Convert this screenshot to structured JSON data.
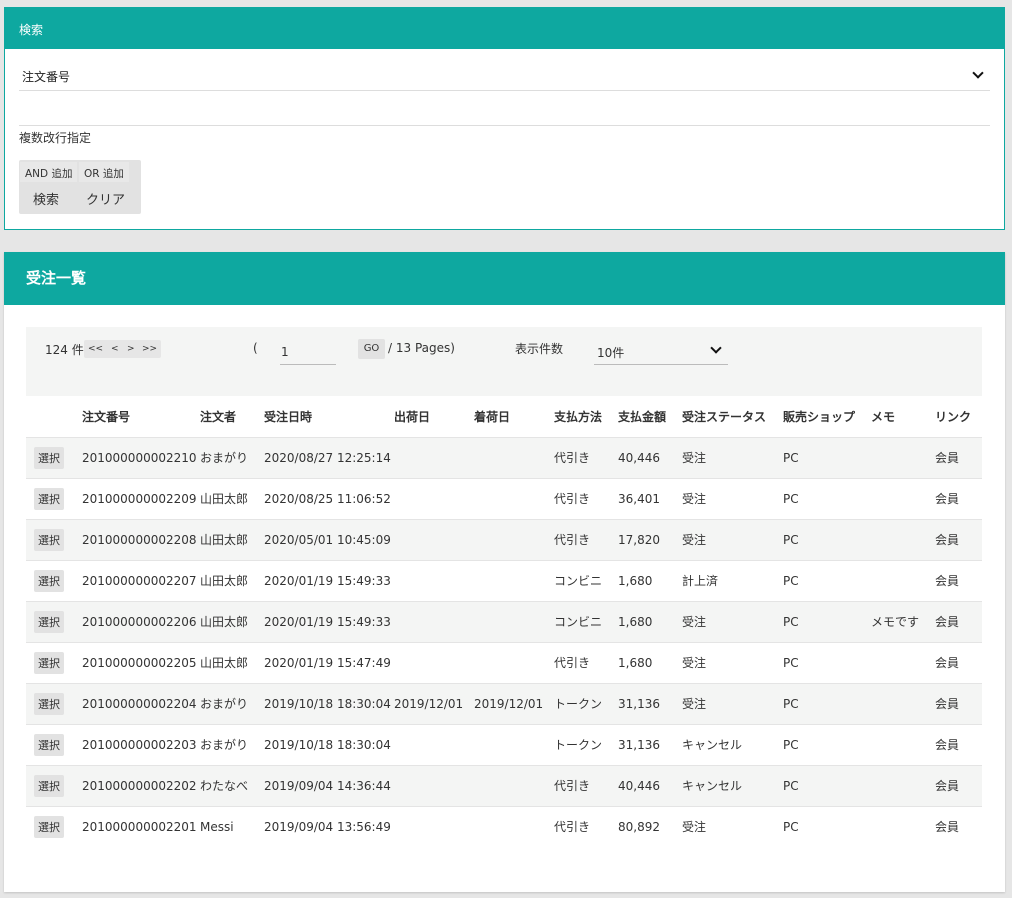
{
  "search": {
    "title": "検索",
    "field_value": "注文番号",
    "multi_line_label": "複数改行指定",
    "and_label": "AND 追加",
    "or_label": "OR 追加",
    "search_label": "検索",
    "clear_label": "クリア"
  },
  "list": {
    "title": "受注一覧",
    "count": "124 件",
    "pager": [
      "<<",
      "<",
      ">",
      ">>"
    ],
    "paren": "(",
    "page_value": "1",
    "go_label": "GO",
    "pages_text": "/ 13 Pages)",
    "per_page_label": "表示件数",
    "per_page_value": "10件",
    "columns": [
      "",
      "注文番号",
      "注文者",
      "受注日時",
      "出荷日",
      "着荷日",
      "支払方法",
      "支払金額",
      "受注ステータス",
      "販売ショップ",
      "メモ",
      "リンク"
    ],
    "select_label": "選択",
    "rows": [
      [
        "201000000002210",
        "おまがり",
        "2020/08/27 12:25:14",
        "",
        "",
        "代引き",
        "40,446",
        "受注",
        "PC",
        "",
        "会員"
      ],
      [
        "201000000002209",
        "山田太郎",
        "2020/08/25 11:06:52",
        "",
        "",
        "代引き",
        "36,401",
        "受注",
        "PC",
        "",
        "会員"
      ],
      [
        "201000000002208",
        "山田太郎",
        "2020/05/01 10:45:09",
        "",
        "",
        "代引き",
        "17,820",
        "受注",
        "PC",
        "",
        "会員"
      ],
      [
        "201000000002207",
        "山田太郎",
        "2020/01/19 15:49:33",
        "",
        "",
        "コンビニ",
        "1,680",
        "計上済",
        "PC",
        "",
        "会員"
      ],
      [
        "201000000002206",
        "山田太郎",
        "2020/01/19 15:49:33",
        "",
        "",
        "コンビニ",
        "1,680",
        "受注",
        "PC",
        "メモです",
        "会員"
      ],
      [
        "201000000002205",
        "山田太郎",
        "2020/01/19 15:47:49",
        "",
        "",
        "代引き",
        "1,680",
        "受注",
        "PC",
        "",
        "会員"
      ],
      [
        "201000000002204",
        "おまがり",
        "2019/10/18 18:30:04",
        "2019/12/01",
        "2019/12/01",
        "トークン",
        "31,136",
        "受注",
        "PC",
        "",
        "会員"
      ],
      [
        "201000000002203",
        "おまがり",
        "2019/10/18 18:30:04",
        "",
        "",
        "トークン",
        "31,136",
        "キャンセル",
        "PC",
        "",
        "会員"
      ],
      [
        "201000000002202",
        "わたなべ",
        "2019/09/04 14:36:44",
        "",
        "",
        "代引き",
        "40,446",
        "キャンセル",
        "PC",
        "",
        "会員"
      ],
      [
        "201000000002201",
        "Messi",
        "2019/09/04 13:56:49",
        "",
        "",
        "代引き",
        "80,892",
        "受注",
        "PC",
        "",
        "会員"
      ]
    ]
  }
}
